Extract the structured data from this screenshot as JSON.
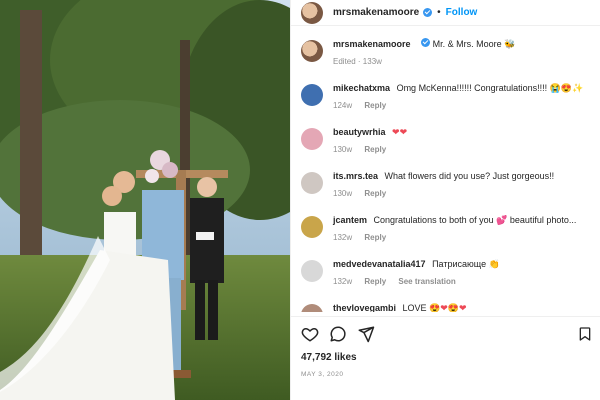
{
  "post": {
    "username": "mrsmakenamoore",
    "follow_label": "Follow",
    "dot": "•"
  },
  "caption": {
    "username": "mrsmakenamoore",
    "text": "Mr. & Mrs. Moore",
    "emoji": "🐝",
    "edited": "Edited · 133w"
  },
  "comments": [
    {
      "username": "mikechatxma",
      "text": "Omg McKenna!!!!!! Congratulations!!!!",
      "emoji": "😭😍✨",
      "age": "124w",
      "reply": "Reply"
    },
    {
      "username": "beautywrhia",
      "text": "",
      "emoji": "❤❤",
      "age": "130w",
      "reply": "Reply"
    },
    {
      "username": "its.mrs.tea",
      "text": "What flowers did you use? Just gorgeous!!",
      "emoji": "",
      "age": "130w",
      "reply": "Reply"
    },
    {
      "username": "jcantem",
      "text": "Congratulations to both of you",
      "emoji": "💕 beautiful photo...",
      "age": "132w",
      "reply": "Reply"
    },
    {
      "username": "medvedevanatalia417",
      "text": "Патрисающе",
      "emoji": "👏",
      "age": "132w",
      "reply": "Reply",
      "extra": "See translation"
    },
    {
      "username": "thevlovegambi",
      "text": "LOVE",
      "emoji": "😍❤😍❤",
      "age": "",
      "reply": ""
    }
  ],
  "footer": {
    "likes": "47,792 likes",
    "date": "MAY 3, 2020"
  },
  "colors": {
    "accent": "#0095f6",
    "verified": "#3897f0",
    "muted": "#8e8e8e"
  },
  "icons": [
    "heart-icon",
    "comment-icon",
    "share-icon",
    "bookmark-icon",
    "verified-icon"
  ]
}
